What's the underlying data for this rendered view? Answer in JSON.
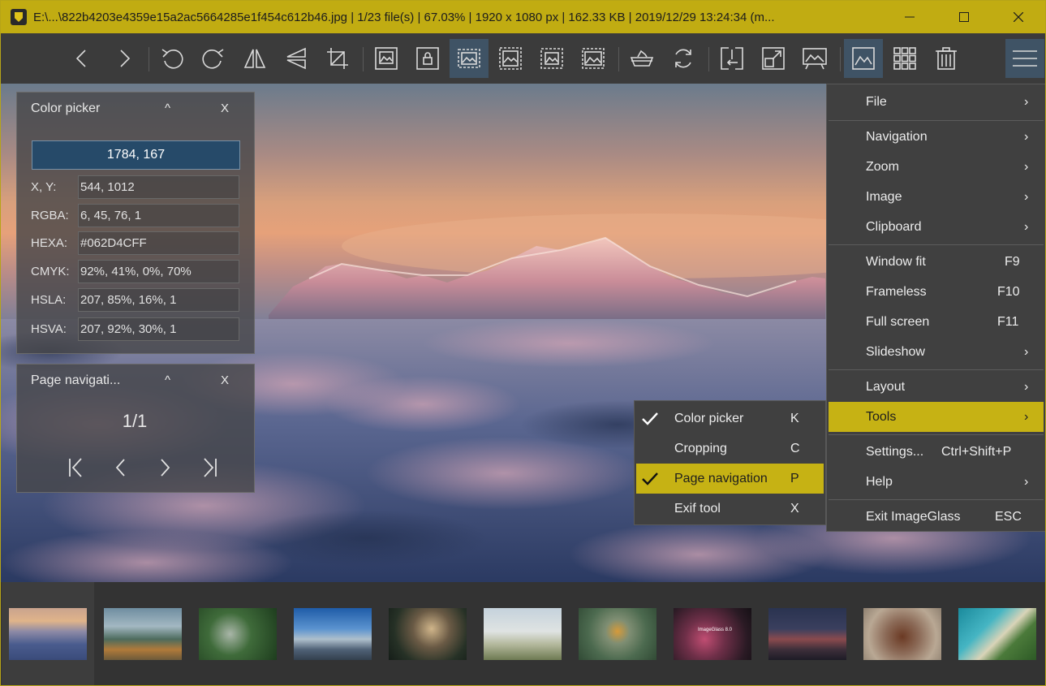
{
  "window": {
    "title": "E:\\...\\822b4203e4359e15a2ac5664285e1f454c612b46.jpg  |  1/23 file(s)  |  67.03%  |  1920 x 1080 px  |  162.33 KB  |  2019/12/29 13:24:34 (m...",
    "controls": [
      "minimize",
      "maximize",
      "close"
    ]
  },
  "toolbar": {
    "buttons": [
      {
        "name": "previous-image",
        "icon": "chevron-left-icon"
      },
      {
        "name": "next-image",
        "icon": "chevron-right-icon"
      },
      {
        "name": "rotate-left",
        "icon": "rotate-left-icon"
      },
      {
        "name": "rotate-right",
        "icon": "rotate-right-icon"
      },
      {
        "name": "flip-horizontal",
        "icon": "flip-horizontal-icon"
      },
      {
        "name": "flip-vertical",
        "icon": "flip-vertical-icon"
      },
      {
        "name": "crop",
        "icon": "crop-icon"
      },
      {
        "name": "auto-zoom",
        "icon": "image-icon"
      },
      {
        "name": "lock-zoom",
        "icon": "image-lock-icon"
      },
      {
        "name": "scale-to-width",
        "icon": "image-fit-icon",
        "active": true
      },
      {
        "name": "scale-to-height",
        "icon": "image-height-icon"
      },
      {
        "name": "scale-to-fit",
        "icon": "image-fit-dashed-icon"
      },
      {
        "name": "scale-to-fill",
        "icon": "image-fill-icon"
      },
      {
        "name": "open-with",
        "icon": "bowl-icon"
      },
      {
        "name": "refresh",
        "icon": "refresh-icon"
      },
      {
        "name": "go-to",
        "icon": "goto-icon"
      },
      {
        "name": "full-screen",
        "icon": "fullscreen-icon"
      },
      {
        "name": "slideshow",
        "icon": "slideshow-icon"
      },
      {
        "name": "thumbnail-bar",
        "icon": "thumbnail-icon",
        "active": true
      },
      {
        "name": "checkerboard",
        "icon": "grid-icon"
      },
      {
        "name": "delete",
        "icon": "trash-icon"
      },
      {
        "name": "main-menu",
        "icon": "hamburger-icon",
        "active": true
      }
    ]
  },
  "color_picker": {
    "title": "Color picker",
    "collapse": "^",
    "close": "X",
    "location": "1784, 167",
    "rows": [
      {
        "label": "X, Y:",
        "value": "544, 1012"
      },
      {
        "label": "RGBA:",
        "value": "6, 45, 76, 1"
      },
      {
        "label": "HEXA:",
        "value": "#062D4CFF"
      },
      {
        "label": "CMYK:",
        "value": "92%, 41%, 0%, 70%"
      },
      {
        "label": "HSLA:",
        "value": "207, 85%, 16%, 1"
      },
      {
        "label": "HSVA:",
        "value": "207, 92%, 30%, 1"
      }
    ]
  },
  "page_navigation": {
    "title": "Page navigati...",
    "collapse": "^",
    "close": "X",
    "page": "1/1"
  },
  "main_menu": {
    "items": [
      {
        "label": "File",
        "shortcut": "",
        "submenu": true
      },
      {
        "label": "Navigation",
        "shortcut": "",
        "submenu": true
      },
      {
        "label": "Zoom",
        "shortcut": "",
        "submenu": true
      },
      {
        "label": "Image",
        "shortcut": "",
        "submenu": true
      },
      {
        "label": "Clipboard",
        "shortcut": "",
        "submenu": true
      },
      {
        "label": "Window fit",
        "shortcut": "F9",
        "submenu": false
      },
      {
        "label": "Frameless",
        "shortcut": "F10",
        "submenu": false
      },
      {
        "label": "Full screen",
        "shortcut": "F11",
        "submenu": false
      },
      {
        "label": "Slideshow",
        "shortcut": "",
        "submenu": true
      },
      {
        "label": "Layout",
        "shortcut": "",
        "submenu": true
      },
      {
        "label": "Tools",
        "shortcut": "",
        "submenu": true,
        "highlighted": true
      },
      {
        "label": "Settings...",
        "shortcut": "Ctrl+Shift+P",
        "submenu": false
      },
      {
        "label": "Help",
        "shortcut": "",
        "submenu": true
      },
      {
        "label": "Exit ImageGlass",
        "shortcut": "ESC",
        "submenu": false
      }
    ]
  },
  "tools_menu": {
    "items": [
      {
        "label": "Color picker",
        "shortcut": "K",
        "checked": true
      },
      {
        "label": "Cropping",
        "shortcut": "C",
        "checked": false
      },
      {
        "label": "Page navigation",
        "shortcut": "P",
        "checked": true,
        "highlighted": true
      },
      {
        "label": "Exif tool",
        "shortcut": "X",
        "checked": false
      }
    ]
  },
  "thumbnails": {
    "count_visible": 11,
    "selected_index": 0,
    "overlay_text": "ImageGlass 8.0"
  },
  "colors": {
    "accent": "#c1ac12",
    "menu_bg": "#404040",
    "toolbar_bg": "#3b3b3b",
    "active_button": "#3f5365",
    "picker_button": "#264a69"
  }
}
